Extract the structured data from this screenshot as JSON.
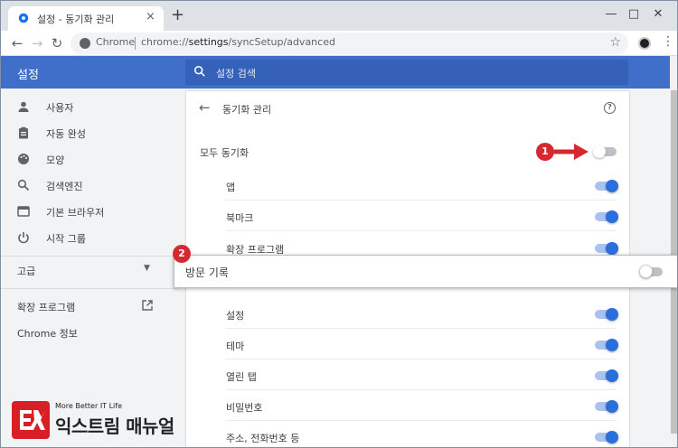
{
  "browser": {
    "tab_title": "설정 - 동기화 관리",
    "tab_close": "×",
    "new_tab": "+",
    "omnibox_site": "Chrome",
    "omnibox_url_prefix": "chrome://",
    "omnibox_url_host": "settings",
    "omnibox_url_path": "/syncSetup/advanced"
  },
  "header": {
    "title": "설정",
    "search_placeholder": "설정 검색"
  },
  "sidebar": {
    "items": [
      {
        "label": "사용자",
        "icon": "person-icon"
      },
      {
        "label": "자동 완성",
        "icon": "clipboard-icon"
      },
      {
        "label": "모양",
        "icon": "palette-icon"
      },
      {
        "label": "검색엔진",
        "icon": "search-icon"
      },
      {
        "label": "기본 브라우저",
        "icon": "browser-icon"
      },
      {
        "label": "시작 그룹",
        "icon": "power-icon"
      }
    ],
    "advanced": "고급",
    "extensions": "확장 프로그램",
    "about": "Chrome 정보"
  },
  "sync": {
    "title": "동기화 관리",
    "sync_all_label": "모두 동기화",
    "sync_all_on": false,
    "rows": [
      {
        "label": "앱",
        "on": true
      },
      {
        "label": "북마크",
        "on": true
      },
      {
        "label": "확장 프로그램",
        "on": true
      },
      {
        "label": "설정",
        "on": true
      },
      {
        "label": "테마",
        "on": true
      },
      {
        "label": "열린 탭",
        "on": true
      },
      {
        "label": "비밀번호",
        "on": true
      },
      {
        "label": "주소, 전화번호 등",
        "on": true
      }
    ]
  },
  "callout": {
    "label": "방문 기록",
    "on": false
  },
  "badges": {
    "one": "1",
    "two": "2"
  },
  "watermark": {
    "tagline": "More Better IT Life",
    "brand": "익스트림 매뉴얼"
  },
  "colors": {
    "accent": "#3f6fc8",
    "toggle_on": "#2a6fdb",
    "badge": "#d5282f"
  }
}
